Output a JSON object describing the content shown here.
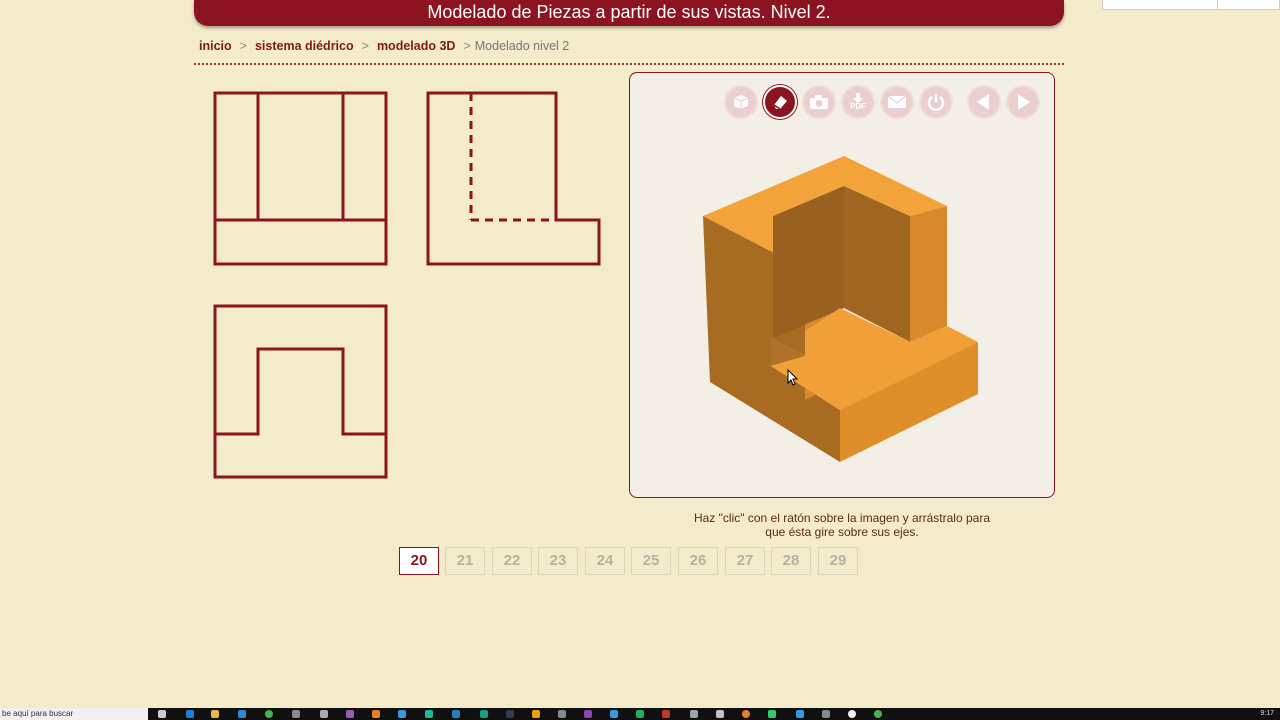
{
  "header": {
    "title": "Modelado de Piezas a partir de sus vistas. Nivel 2."
  },
  "breadcrumb": {
    "items": [
      "inicio",
      "sistema diédrico",
      "modelado 3D"
    ],
    "current": "Modelado nivel 2",
    "separator": ">"
  },
  "toolbar": {
    "tools": [
      {
        "icon": "cube-icon",
        "state": "faded"
      },
      {
        "icon": "eraser-icon",
        "state": "active"
      },
      {
        "icon": "camera-icon",
        "state": "faded"
      },
      {
        "icon": "pdf-download-icon",
        "label": "PDF",
        "state": "faded"
      },
      {
        "icon": "mail-icon",
        "state": "faded"
      },
      {
        "icon": "power-icon",
        "state": "faded"
      },
      {
        "icon": "previous-arrow-icon",
        "state": "faded"
      },
      {
        "icon": "next-arrow-icon",
        "state": "faded"
      }
    ]
  },
  "caption": {
    "line1": "Haz \"clic\" con el ratón sobre la imagen y arrástralo para",
    "line2": "que ésta gire sobre sus ejes."
  },
  "pagination": {
    "pages": [
      "20",
      "21",
      "22",
      "23",
      "24",
      "25",
      "26",
      "27",
      "28",
      "29"
    ],
    "current": "20"
  },
  "taskbar": {
    "search_placeholder": "be aquí para buscar",
    "clock": "9:17"
  },
  "colors": {
    "accent": "#8c1420",
    "background": "#f4ebcb",
    "model_top": "#f2a43a",
    "model_left": "#a66a22",
    "model_right": "#df8f2a"
  }
}
